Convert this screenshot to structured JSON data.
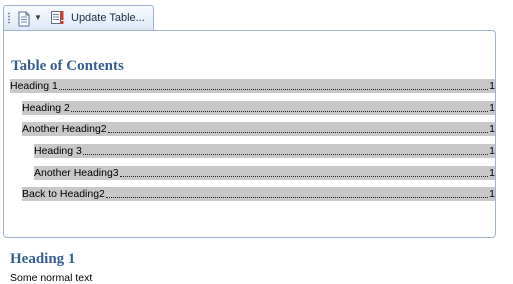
{
  "toolbar": {
    "update_label": "Update Table..."
  },
  "toc": {
    "title": "Table of Contents",
    "entries": [
      {
        "text": "Heading 1",
        "page": "1"
      },
      {
        "text": "Heading 2",
        "page": "1"
      },
      {
        "text": "Another Heading2",
        "page": "1"
      },
      {
        "text": "Heading 3",
        "page": "1"
      },
      {
        "text": "Another Heading3",
        "page": "1"
      },
      {
        "text": "Back to Heading2",
        "page": "1"
      }
    ]
  },
  "body": {
    "heading": "Heading 1",
    "text": "Some normal text"
  },
  "icons": {
    "grip": "grip-icon",
    "toc_menu": "document-icon",
    "dropdown": "chevron-down-icon",
    "update": "update-table-icon"
  },
  "colors": {
    "heading": "#365f91",
    "entry_highlight": "#c8c8c8",
    "control_border": "#9fb3cf"
  }
}
